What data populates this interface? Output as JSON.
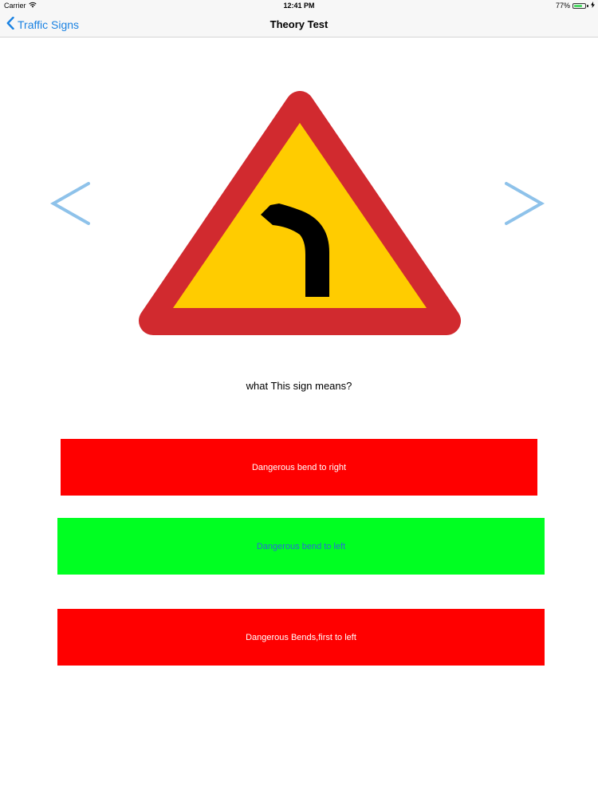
{
  "status_bar": {
    "carrier": "Carrier",
    "time": "12:41 PM",
    "battery_percent": "77%",
    "battery_level": 0.77,
    "battery_color": "#4cd964"
  },
  "nav": {
    "back_label": "Traffic Signs",
    "back_icon": "chevron-left-icon",
    "title": "Theory Test",
    "accent_color": "#1a82e2"
  },
  "navigation_arrows": {
    "prev_icon": "chevron-left-icon",
    "next_icon": "chevron-right-icon",
    "color": "#8ec2ea"
  },
  "sign": {
    "icon": "dangerous-bend-left-sign-icon",
    "border_color": "#d12a2f",
    "fill_color": "#ffcc00",
    "symbol_color": "#000000"
  },
  "question": "what This sign means?",
  "answers": [
    {
      "label": "Dangerous bend to right",
      "bg_color": "#ff0000",
      "text_color": "#ffffff"
    },
    {
      "label": "Dangerous bend to left",
      "bg_color": "#00ff22",
      "text_color": "#2a6cd6"
    },
    {
      "label": "Dangerous Bends,first to left",
      "bg_color": "#ff0000",
      "text_color": "#ffffff"
    }
  ]
}
